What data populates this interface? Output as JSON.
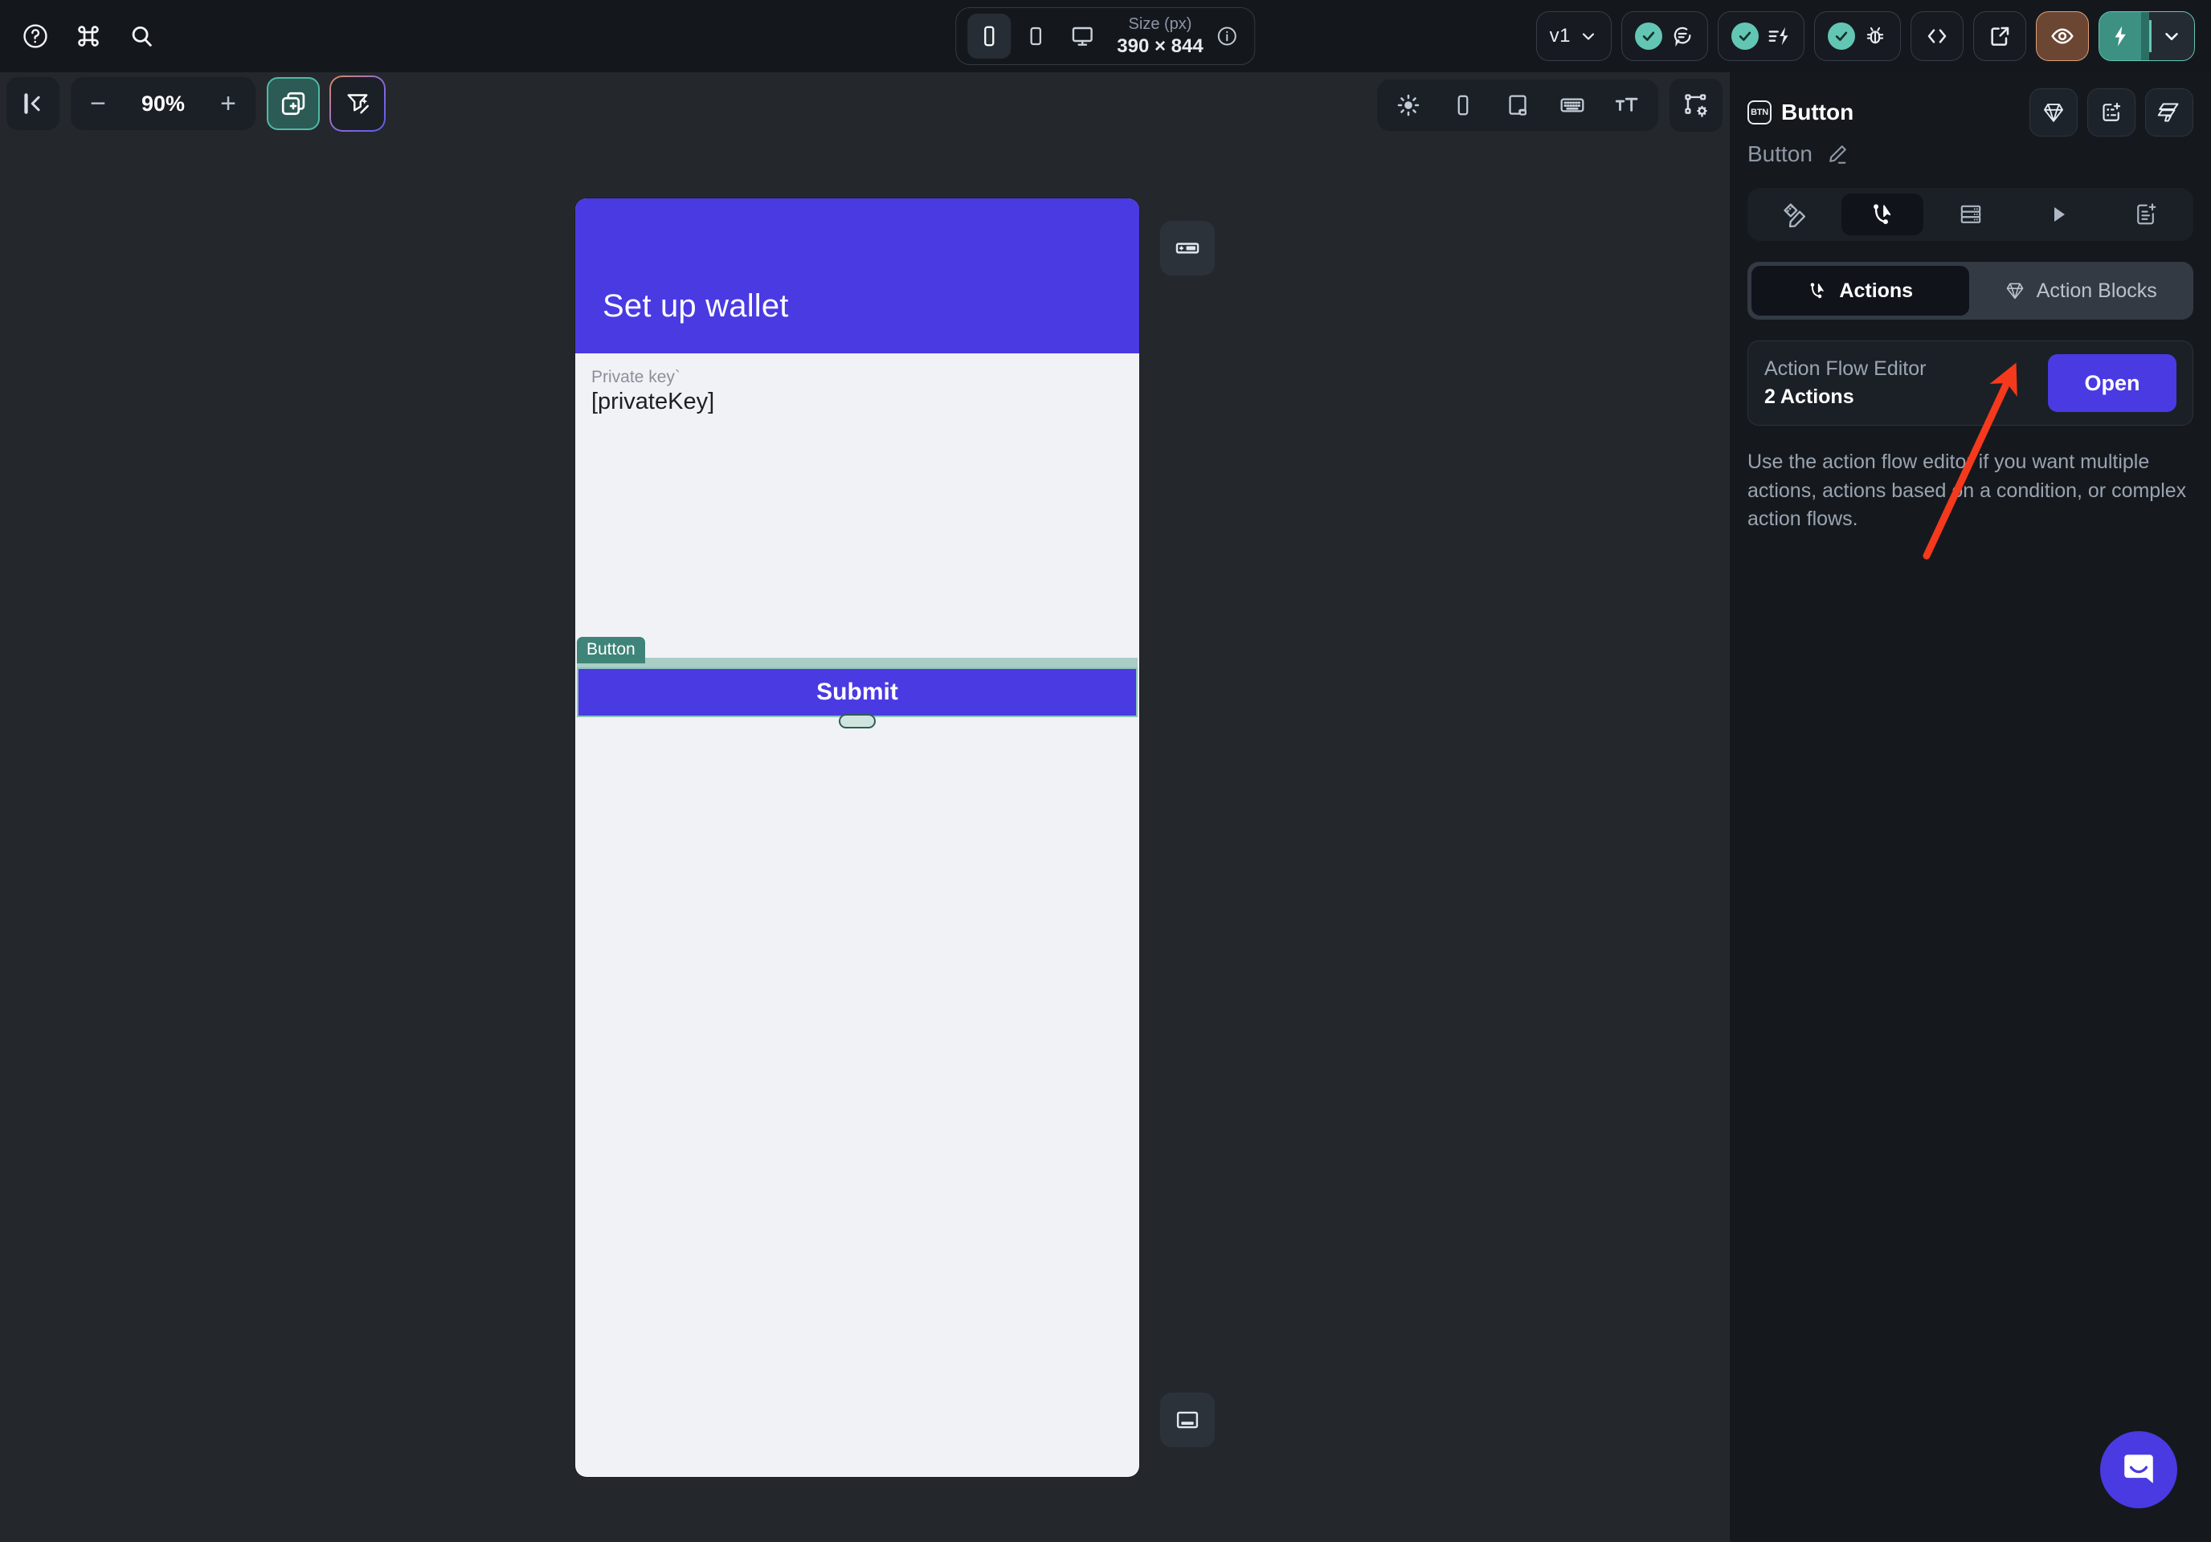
{
  "topbar": {
    "icons": [
      {
        "name": "help-icon",
        "glyph": "?"
      },
      {
        "name": "command-icon",
        "glyph": "⌘"
      },
      {
        "name": "search-icon",
        "glyph": "search"
      }
    ],
    "size_group": {
      "label": "Size (px)",
      "value": "390 × 844",
      "devices": [
        {
          "name": "device-phone",
          "active": true
        },
        {
          "name": "device-tablet",
          "active": false
        },
        {
          "name": "device-desktop",
          "active": false
        }
      ],
      "info_tooltip": "info-icon"
    },
    "right": {
      "version_label": "v1",
      "comments_icon": "comment-icon",
      "performance_icon": "lightning-lines-icon",
      "debug_icon": "bug-icon",
      "code_icon": "code-brackets-icon",
      "share_icon": "external-link-icon",
      "preview_icon": "eye-icon",
      "publish_icon": "lightning-bolt-icon",
      "publish_caret": "chevron-down-icon"
    }
  },
  "secondbar": {
    "collapse_icon": "collapse-panel-icon",
    "zoom": {
      "minus": "−",
      "value": "90%",
      "plus": "+"
    },
    "add_component_icon": "add-layer-icon",
    "ai_design_icon": "ai-magic-icon",
    "tray_icons": [
      "theme-sun-icon",
      "device-frame-icon",
      "responsive-layout-icon",
      "keyboard-icon",
      "typography-icon"
    ],
    "selection_settings_icon": "selection-settings-icon"
  },
  "canvas": {
    "float_top_icon": "add-header-icon",
    "float_bottom_icon": "add-footer-icon",
    "phone": {
      "header_title": "Set up wallet",
      "field_label": "Private key`",
      "field_value": "[privateKey]",
      "selection_tag": "Button",
      "submit_label": "Submit"
    }
  },
  "right_panel": {
    "badge": "BTN",
    "title": "Button",
    "subtitle": "Button",
    "edit_icon": "pencil-icon",
    "header_icons": [
      "diamond-icon",
      "add-variable-icon",
      "layers-icon"
    ],
    "tabs": [
      {
        "name": "tab-properties",
        "icon": "ruler-pencil-icon",
        "active": false
      },
      {
        "name": "tab-actions",
        "icon": "action-node-icon",
        "active": true
      },
      {
        "name": "tab-backend",
        "icon": "database-icon",
        "active": false
      },
      {
        "name": "tab-run",
        "icon": "play-icon",
        "active": false
      },
      {
        "name": "tab-notes",
        "icon": "add-note-icon",
        "active": false
      }
    ],
    "segments": [
      {
        "name": "segment-actions",
        "label": "Actions",
        "icon": "action-node-icon",
        "active": true
      },
      {
        "name": "segment-action-blocks",
        "label": "Action Blocks",
        "icon": "diamond-icon",
        "active": false
      }
    ],
    "action_flow_card": {
      "title": "Action Flow Editor",
      "count": "2 Actions",
      "open_label": "Open"
    },
    "description": "Use the action flow editor if you want multiple actions, actions based on a condition, or complex action flows."
  },
  "annotation": {
    "arrow_color": "#f4391c"
  },
  "chat": {
    "icon": "chat-bubble-icon"
  },
  "colors": {
    "accent_blue": "#4a3ae2",
    "accent_teal": "#63c6b4",
    "canvas_bg": "#24282d",
    "topbar_bg": "#14181d",
    "panel_bg": "#15191e"
  }
}
